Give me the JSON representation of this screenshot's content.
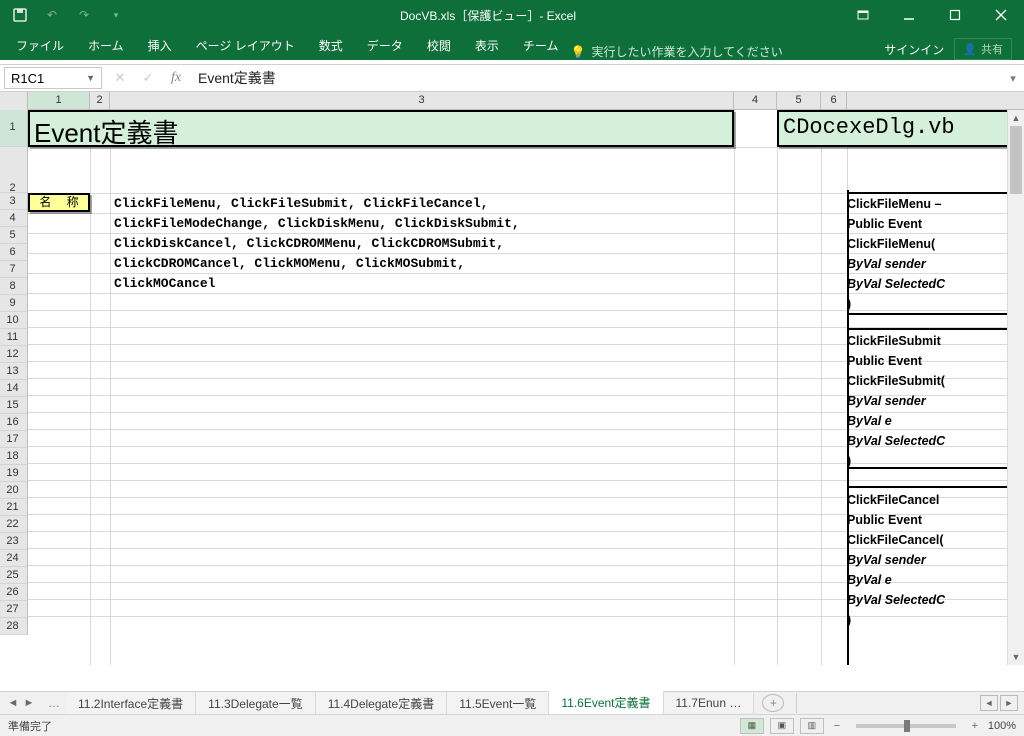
{
  "title": "DocVB.xls［保護ビュー］- Excel",
  "qat": {
    "save": "save",
    "undo": "undo",
    "redo": "redo"
  },
  "tabs": {
    "file": "ファイル",
    "home": "ホーム",
    "insert": "挿入",
    "pagelayout": "ページ レイアウト",
    "formulas": "数式",
    "data": "データ",
    "review": "校閲",
    "view": "表示",
    "team": "チーム"
  },
  "tell_me": "実行したい作業を入力してください",
  "signin": "サインイン",
  "share": "共有",
  "namebox": "R1C1",
  "formula": "Event定義書",
  "columns": {
    "c1": "1",
    "c2": "2",
    "c3": "3",
    "c4": "4",
    "c5": "5",
    "c6": "6"
  },
  "title_cell": "Event定義書",
  "file_cell": "CDocexeDlg.vb",
  "label_cell": "名 称",
  "name_lines": [
    "ClickFileMenu, ClickFileSubmit, ClickFileCancel,",
    "ClickFileModeChange, ClickDiskMenu, ClickDiskSubmit,",
    "ClickDiskCancel, ClickCDROMMenu, ClickCDROMSubmit,",
    "ClickCDROMCancel, ClickMOMenu, ClickMOSubmit,",
    "ClickMOCancel"
  ],
  "right_blocks": [
    [
      "ClickFileMenu –",
      "Public Event",
      "ClickFileMenu(",
      "  ByVal sender",
      "  ByVal SelectedC",
      ")"
    ],
    [
      "ClickFileSubmit",
      "Public Event",
      "ClickFileSubmit(",
      "  ByVal sender",
      "  ByVal e",
      "  ByVal SelectedC",
      ")"
    ],
    [
      "ClickFileCancel",
      "Public Event",
      "ClickFileCancel(",
      "  ByVal sender",
      "  ByVal e",
      "  ByVal SelectedC",
      ")"
    ]
  ],
  "sheet_tabs": {
    "prev": "11.2Interface定義書",
    "t2": "11.3Delegate一覧",
    "t3": "11.4Delegate定義書",
    "t4": "11.5Event一覧",
    "active": "11.6Event定義書",
    "next": "11.7Enun …"
  },
  "status": "準備完了",
  "zoom": "100%"
}
